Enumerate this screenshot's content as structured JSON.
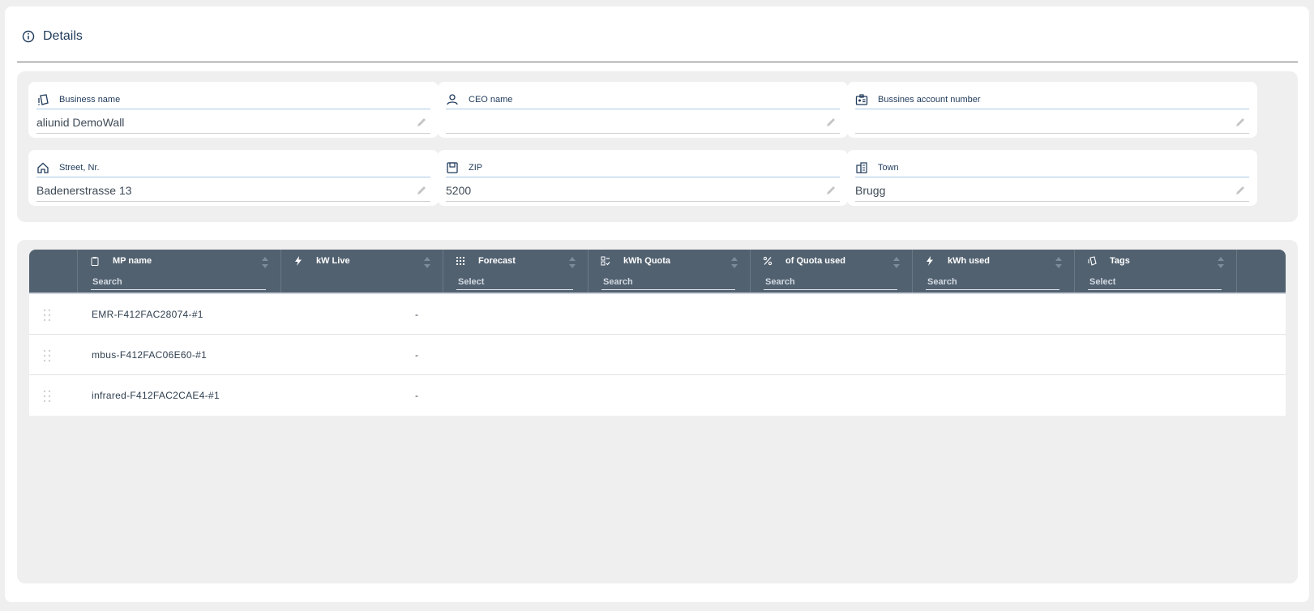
{
  "section": {
    "title": "Details",
    "icon": "info-icon"
  },
  "fields": [
    {
      "id": "business-name",
      "label": "Business name",
      "value": "aliunid DemoWall",
      "icon": "tag-icon"
    },
    {
      "id": "ceo-name",
      "label": "CEO name",
      "value": "",
      "icon": "person-icon"
    },
    {
      "id": "account-number",
      "label": "Bussines account number",
      "value": "",
      "icon": "id-card-icon"
    },
    {
      "id": "street",
      "label": "Street, Nr.",
      "value": "Badenerstrasse 13",
      "icon": "home-icon"
    },
    {
      "id": "zip",
      "label": "ZIP",
      "value": "5200",
      "icon": "mailbox-icon"
    },
    {
      "id": "town",
      "label": "Town",
      "value": "Brugg",
      "icon": "city-icon"
    }
  ],
  "table": {
    "columns": [
      {
        "id": "drag",
        "label": "",
        "filter": ""
      },
      {
        "id": "mp-name",
        "label": "MP name",
        "filter": "Search",
        "icon": "clipboard-icon"
      },
      {
        "id": "kw-live",
        "label": "kW Live",
        "filter": "",
        "icon": "bolt-icon"
      },
      {
        "id": "forecast",
        "label": "Forecast",
        "filter": "Select",
        "icon": "grid-icon"
      },
      {
        "id": "kwh-quota",
        "label": "kWh Quota",
        "filter": "Search",
        "icon": "quota-icon"
      },
      {
        "id": "quota-used",
        "label": "of Quota used",
        "filter": "Search",
        "icon": "percent-icon"
      },
      {
        "id": "kwh-used",
        "label": "kWh used",
        "filter": "Search",
        "icon": "bolt-icon"
      },
      {
        "id": "tags",
        "label": "Tags",
        "filter": "Select",
        "icon": "tag-icon"
      }
    ],
    "rows": [
      {
        "mp_name": "EMR-F412FAC28074-#1",
        "kw_live": "-"
      },
      {
        "mp_name": "mbus-F412FAC06E60-#1",
        "kw_live": "-"
      },
      {
        "mp_name": "infrared-F412FAC2CAE4-#1",
        "kw_live": "-"
      }
    ]
  },
  "colors": {
    "header_bg": "#526170",
    "accent": "#1f3a5a",
    "panel_bg": "#efefef"
  }
}
